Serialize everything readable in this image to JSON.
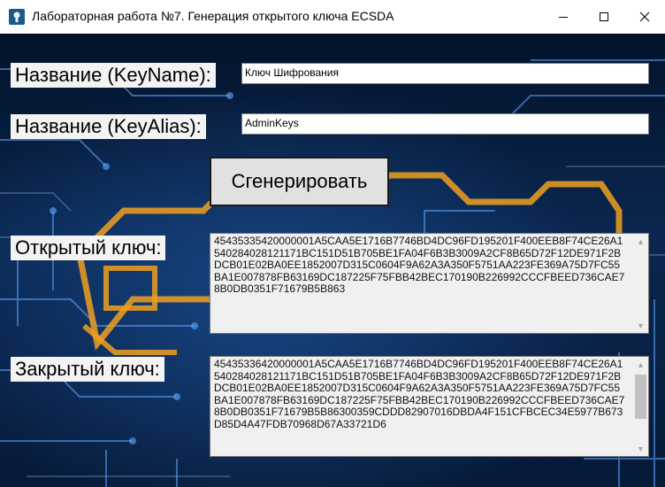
{
  "window": {
    "title": "Лабораторная работа №7. Генерация открытого ключа ECSDA",
    "icon": "keyhole-lock-icon",
    "controls": [
      "minimize-icon",
      "maximize-icon",
      "close-icon"
    ]
  },
  "form": {
    "key_name_label": "Название (KeyName):",
    "key_name_value": "Ключ Шифрования",
    "key_alias_label": "Название (KeyAlias):",
    "key_alias_value": "AdminKeys",
    "generate_label": "Сгенерировать",
    "public_key_label": "Открытый ключ:",
    "public_key_value": "45435335420000001A5CAA5E1716B7746BD4DC96FD195201F400EEB8F74CE26A1540284028121171BC151D51B705BE1FA04F6B3B3009A2CF8B65D72F12DE971F2BDCB01E02BA0EE1852007D315C0604F9A62A3A350F5751AA223FE369A75D7FC55BA1E007878FB63169DC187225F75FBB42BEC170190B226992CCCFBEED736CAE78B0DB0351F71679B5B863",
    "private_key_label": "Закрытый ключ:",
    "private_key_value": "45435336420000001A5CAA5E1716B7746BD4DC96FD195201F400EEB8F74CE26A1540284028121171BC151D51B705BE1FA04F6B3B3009A2CF8B65D72F12DE971F2BDCB01E02BA0EE1852007D315C0604F9A62A3A350F5751AA223FE369A75D7FC55BA1E007878FB63169DC187225F75FBB42BEC170190B226992CCCFBEED736CAE78B0DB0351F71679B5B86300359CDDD82907016DBDA4F151CFBCEC34E5977B673D85D4A47FDB70968D67A33721D6"
  },
  "colors": {
    "accent_orange": "#f0a020",
    "background_blue": "#0a2750"
  }
}
